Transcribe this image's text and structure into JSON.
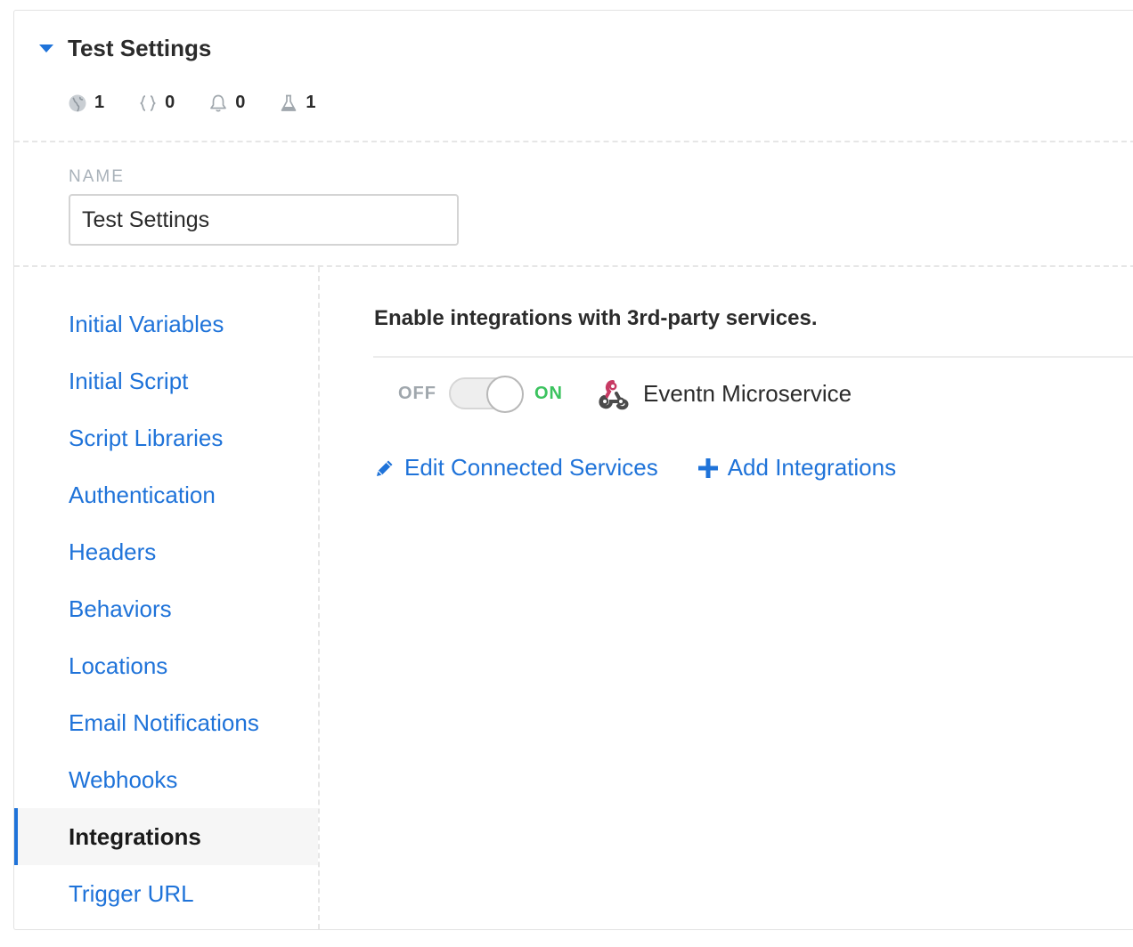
{
  "header": {
    "title": "Test Settings",
    "stats": [
      {
        "icon": "globe-icon",
        "count": "1"
      },
      {
        "icon": "braces-icon",
        "count": "0"
      },
      {
        "icon": "bell-icon",
        "count": "0"
      },
      {
        "icon": "flask-icon",
        "count": "1"
      }
    ]
  },
  "name_section": {
    "label": "NAME",
    "value": "Test Settings"
  },
  "sidebar": {
    "items": [
      {
        "label": "Initial Variables",
        "active": false
      },
      {
        "label": "Initial Script",
        "active": false
      },
      {
        "label": "Script Libraries",
        "active": false
      },
      {
        "label": "Authentication",
        "active": false
      },
      {
        "label": "Headers",
        "active": false
      },
      {
        "label": "Behaviors",
        "active": false
      },
      {
        "label": "Locations",
        "active": false
      },
      {
        "label": "Email Notifications",
        "active": false
      },
      {
        "label": "Webhooks",
        "active": false
      },
      {
        "label": "Integrations",
        "active": true
      },
      {
        "label": "Trigger URL",
        "active": false
      }
    ]
  },
  "content": {
    "title": "Enable integrations with 3rd-party services.",
    "integration": {
      "off_label": "OFF",
      "on_label": "ON",
      "enabled": true,
      "service_icon": "webhook-icon",
      "service_name": "Eventn Microservice"
    },
    "actions": {
      "edit_label": "Edit Connected Services",
      "add_label": "Add Integrations"
    }
  },
  "colors": {
    "accent": "#1f73d9",
    "on_green": "#3cc35f",
    "muted": "#a0a7ad",
    "webhook_red": "#c73a63"
  }
}
